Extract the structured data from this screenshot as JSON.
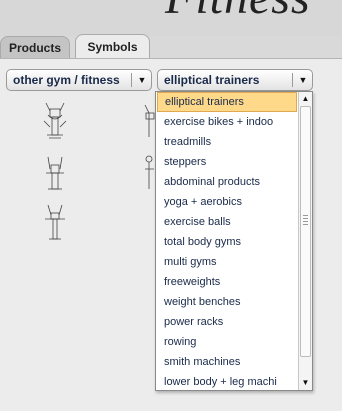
{
  "header": {
    "title": "Fitness"
  },
  "tabs": [
    {
      "label": "Products",
      "active": false
    },
    {
      "label": "Symbols",
      "active": true
    }
  ],
  "selects": {
    "category": {
      "value": "other gym / fitness"
    },
    "subcategory": {
      "value": "elliptical trainers"
    }
  },
  "dropdown": {
    "selected_index": 0,
    "options": [
      "elliptical trainers",
      "exercise bikes + indoo",
      "treadmills",
      "steppers",
      "abdominal products",
      "yoga + aerobics",
      "exercise balls",
      "total body gyms",
      "multi gyms",
      "freeweights",
      "weight benches",
      "power racks",
      "rowing",
      "smith machines",
      "lower body + leg machi"
    ]
  },
  "icons": {
    "select_arrow": "down-triangle-icon",
    "equipment": "elliptical-trainer-symbol-icon"
  },
  "colors": {
    "selected_option_bg": "#ffd98a",
    "option_text": "#1a2a4a"
  }
}
